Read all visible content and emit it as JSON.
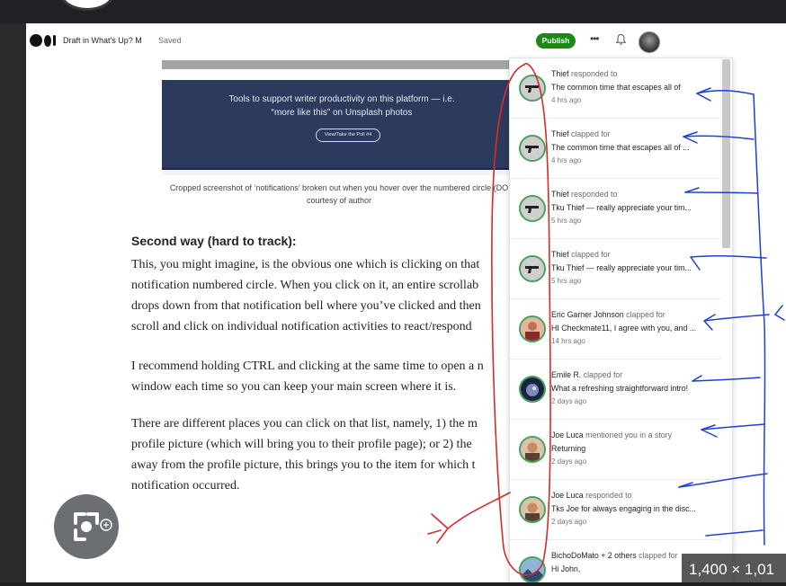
{
  "editor": {
    "draft_label": "Draft in What's Up? M",
    "saved_label": "Saved",
    "publish_label": "Publish",
    "more_label": "•••"
  },
  "article": {
    "banner_line1": "Tools to support writer productivity on this platform — i.e.",
    "banner_line2": "“more like this” on Unsplash photos",
    "banner_button": "View/Take the Poll #4",
    "caption_line1": "Cropped screenshot of ‘notifications’ broken out when you hover over the numbered circle (DO",
    "caption_line2": "courtesy of author",
    "heading": "Second way (hard to track):",
    "paragraph1": [
      "This, you might imagine, is the obvious one which is clicking on that",
      "notification numbered circle. When you click on it, an entire scrollab",
      "drops down from that notification bell where you’ve clicked and then",
      "scroll and click on individual notification activities to react/respond"
    ],
    "paragraph2": [
      "I recommend holding CTRL and clicking at the same time to open a n",
      "window each time so you can keep your main screen where it is."
    ],
    "paragraph3": [
      "There are different places you can click on that list, namely, 1) the m",
      "profile picture (which will bring you to their profile page); or 2) the",
      "away from the profile picture, this brings you to the item for which t",
      "notification occurred."
    ]
  },
  "notifications": [
    {
      "who": "Thief",
      "action": "responded to",
      "text": "The common time that escapes all of",
      "time": "4 hrs ago",
      "avatar": "gun-avatar"
    },
    {
      "who": "Thief",
      "action": "clapped for",
      "text": "The common time that escapes all of ...",
      "time": "4 hrs ago",
      "avatar": "gun-avatar"
    },
    {
      "who": "Thief",
      "action": "responded to",
      "text": "Tku Thief — really appreciate your tim...",
      "time": "5 hrs ago",
      "avatar": "gun-avatar"
    },
    {
      "who": "Thief",
      "action": "clapped for",
      "text": "Tku Thief — really appreciate your tim...",
      "time": "5 hrs ago",
      "avatar": "gun-avatar"
    },
    {
      "who": "Eric Garner Johnson",
      "action": "clapped for",
      "text": "HI Checkmate11, I agree with you, and ...",
      "time": "14 hrs ago",
      "avatar": "person-avatar"
    },
    {
      "who": "Emile R.",
      "action": "clapped for",
      "text": "What a refreshing straightforward intro!",
      "time": "2 days ago",
      "avatar": "planet-avatar"
    },
    {
      "who": "Joe Luca",
      "action": "mentioned you in a story",
      "text": "Returning",
      "time": "2 days ago",
      "avatar": "person-avatar"
    },
    {
      "who": "Joe Luca",
      "action": "responded to",
      "text": "Tks Joe for always engaging in the disc...",
      "time": "2 days ago",
      "avatar": "person-avatar"
    },
    {
      "who": "BichoDoMato + 2 others",
      "action": "clapped for",
      "text": "Hi John,",
      "time": "",
      "avatar": "landscape-avatar"
    }
  ],
  "overlay": {
    "image_dimensions": "1,400 × 1,01"
  },
  "colors": {
    "publish_green": "#1a8917",
    "annotation_red": "#d42b2b",
    "annotation_blue": "#1f3fd6",
    "banner_navy": "#2c3a5e"
  }
}
